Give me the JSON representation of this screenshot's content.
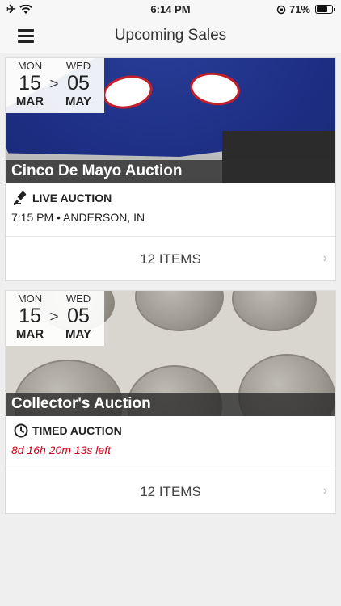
{
  "status_bar": {
    "time": "6:14 PM",
    "battery": "71%"
  },
  "header": {
    "title": "Upcoming Sales"
  },
  "sales": [
    {
      "title": "Cinco De Mayo Auction",
      "start": {
        "dow": "MON",
        "day": "15",
        "month": "MAR"
      },
      "end": {
        "dow": "WED",
        "day": "05",
        "month": "MAY"
      },
      "separator": ">",
      "type": "LIVE AUCTION",
      "type_icon": "gavel-icon",
      "detail": "7:15 PM • ANDERSON, IN",
      "items_label": "12 ITEMS"
    },
    {
      "title": "Collector's Auction",
      "start": {
        "dow": "MON",
        "day": "15",
        "month": "MAR"
      },
      "end": {
        "dow": "WED",
        "day": "05",
        "month": "MAY"
      },
      "separator": ">",
      "type": "TIMED AUCTION",
      "type_icon": "clock-icon",
      "detail": "8d 16h 20m 13s left",
      "detail_color": "#d0021b",
      "items_label": "12 ITEMS"
    }
  ]
}
